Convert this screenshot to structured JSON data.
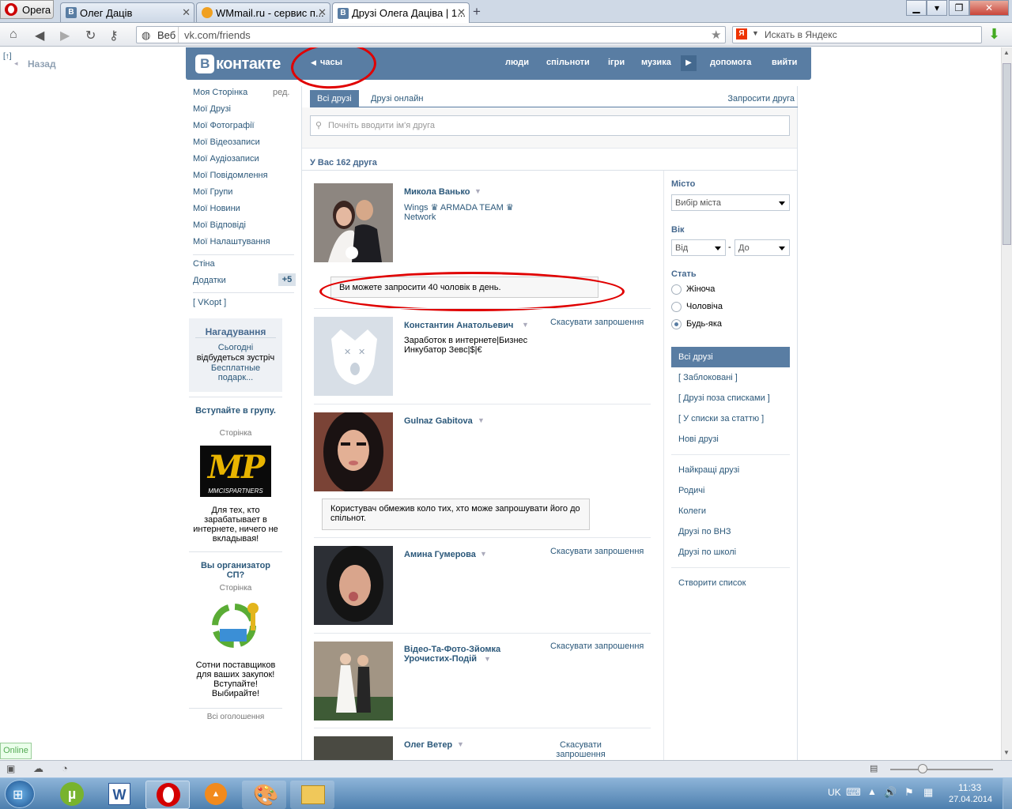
{
  "browser": {
    "opera_label": "Opera",
    "tabs": [
      {
        "label": "Олег Дацiв",
        "icon": "vk-icon"
      },
      {
        "label": "WMmail.ru - сервис п...",
        "icon": "wmmail-icon"
      },
      {
        "label": "Друзi Олега Дацiва | 1...",
        "icon": "vk-icon"
      }
    ],
    "url_prefix": "Веб",
    "url": "vk.com/friends",
    "search_placeholder": "Искать в Яндекс",
    "back_panel": "Назад",
    "online_badge": "Online"
  },
  "vk": {
    "logo": "контакте",
    "logo_b": "В",
    "back_label": "часы",
    "topnav": [
      "люди",
      "спільноти",
      "ігри",
      "музика",
      "допомога",
      "вийти"
    ],
    "left_menu": [
      "Моя Сторінка",
      "Мої Друзі",
      "Мої Фотографії",
      "Мої Відеозаписи",
      "Мої Аудіозаписи",
      "Мої Повідомлення",
      "Мої Групи",
      "Мої Новини",
      "Мої Відповіді",
      "Мої Налаштування"
    ],
    "edit_label": "ред.",
    "wall": "Стіна",
    "apps": "Додатки",
    "apps_badge": "+5",
    "vkopt": "[ VKopt ]",
    "reminder": {
      "title": "Нагадування",
      "today": "Сьогодні",
      "text": "відбудеться зустріч",
      "link": "Бесплатные подарк..."
    },
    "ad1": {
      "title": "Вступайте в групу.",
      "sub": "Сторінка",
      "logo": "MP",
      "logo_sub": "MMCISPARTNERS",
      "text": "Для тех, кто зарабатывает в интернете, ничего не вкладывая!"
    },
    "ad2": {
      "title": "Вы организатор СП?",
      "sub": "Сторінка",
      "text": "Сотни поставщиков для ваших закупок! Вступайте! Выбирайте!"
    },
    "all_ads": "Всі оголошення",
    "tabs": {
      "all": "Всі друзі",
      "online": "Друзі онлайн",
      "invite": "Запросити друга"
    },
    "search_placeholder": "Почніть вводити ім'я друга",
    "count_label": "У Вас 162 друга",
    "friends": [
      {
        "name": "Микола Ванько",
        "sub": "Wings ♛ ARMADA TEAM ♛ Network",
        "cancel": ""
      },
      {
        "name": "Константин Анатольевич",
        "sub": "Заработок в интернете|Бизнес Инкубатор Зевс|$|€",
        "cancel": "Скасувати запрошення"
      },
      {
        "name": "Gulnaz Gabitova",
        "sub": "",
        "cancel": ""
      },
      {
        "name": "Амина Гумерова",
        "sub": "",
        "cancel": "Скасувати запрошення"
      },
      {
        "name": "Відео-Та-Фото-Зйомка Урочистих-Подій",
        "sub": "",
        "cancel": "Скасувати запрошення"
      },
      {
        "name": "Олег Ветер",
        "sub": "",
        "cancel": "Скасувати запрошення"
      }
    ],
    "notice1": "Ви можете запросити 40 чоловік в день.",
    "notice2": "Користувач обмежив коло тих, хто може запрошувати його до спільнот.",
    "filters": {
      "city_label": "Місто",
      "city_value": "Вибір міста",
      "age_label": "Вік",
      "age_from": "Від",
      "age_to": "До",
      "age_dash": "-",
      "sex_label": "Стать",
      "sex_options": [
        "Жіноча",
        "Чоловіча",
        "Будь-яка"
      ],
      "sex_selected": "Будь-яка"
    },
    "lists": {
      "selected": "Всі друзі",
      "group1": [
        "[ Заблоковані ]",
        "[ Друзі поза списками ]",
        "[ У списки за статтю ]",
        "Нові друзі"
      ],
      "group2": [
        "Найкращі друзі",
        "Родичі",
        "Колеги",
        "Друзі по ВНЗ",
        "Друзі по школі"
      ],
      "create": "Створити список"
    },
    "colors": {
      "header": "#597da3",
      "link": "#2b587a",
      "annotation": "#e00000"
    }
  },
  "taskbar": {
    "lang": "UK",
    "time": "11:33",
    "date": "27.04.2014"
  }
}
